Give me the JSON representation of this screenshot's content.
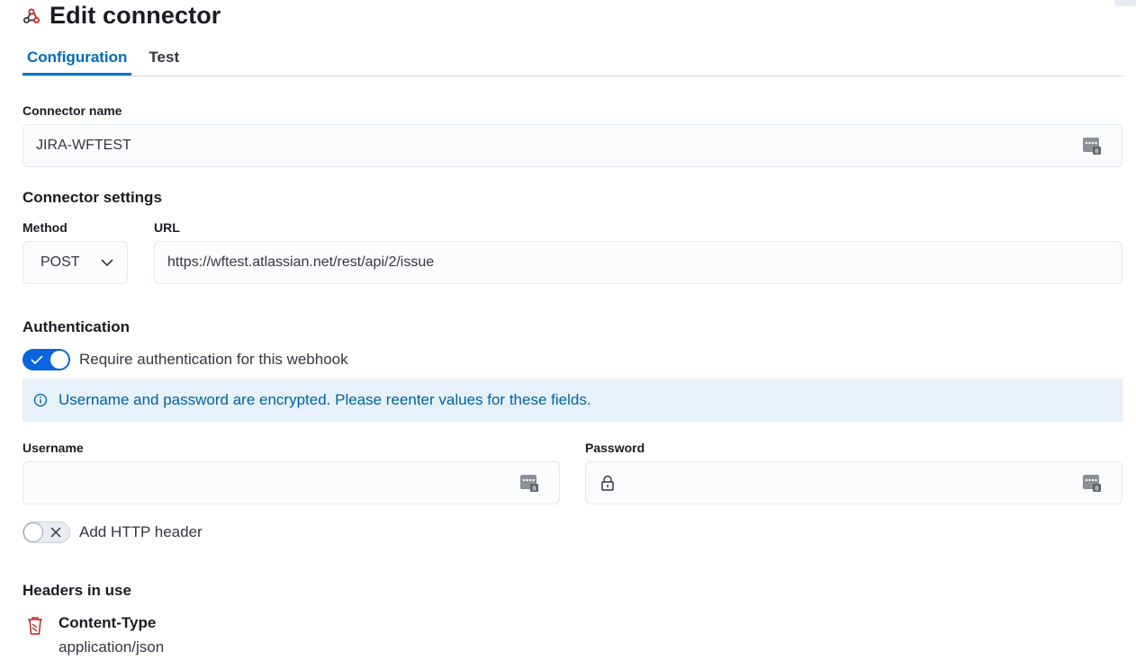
{
  "header": {
    "title": "Edit connector",
    "logo_icon": "webhook-icon",
    "logo_color": "#bd271e"
  },
  "tabs": [
    {
      "label": "Configuration",
      "active": true
    },
    {
      "label": "Test",
      "active": false
    }
  ],
  "connector_name": {
    "label": "Connector name",
    "value": "JIRA-WFTEST"
  },
  "connector_settings": {
    "title": "Connector settings",
    "method": {
      "label": "Method",
      "value": "POST"
    },
    "url": {
      "label": "URL",
      "value": "https://wftest.atlassian.net/rest/api/2/issue"
    }
  },
  "authentication": {
    "title": "Authentication",
    "require_auth": {
      "label": "Require authentication for this webhook",
      "checked": true
    },
    "callout": "Username and password are encrypted. Please reenter values for these fields.",
    "username": {
      "label": "Username",
      "value": ""
    },
    "password": {
      "label": "Password",
      "value": ""
    }
  },
  "http_header": {
    "label": "Add HTTP header",
    "checked": false
  },
  "headers_in_use": {
    "title": "Headers in use",
    "items": [
      {
        "name": "Content-Type",
        "value": "application/json"
      }
    ]
  },
  "colors": {
    "accent": "#0077cc",
    "switch_on": "#0b64dd",
    "callout_bg": "#e6f1fa",
    "callout_text": "#0061a6",
    "danger": "#bd271e"
  }
}
